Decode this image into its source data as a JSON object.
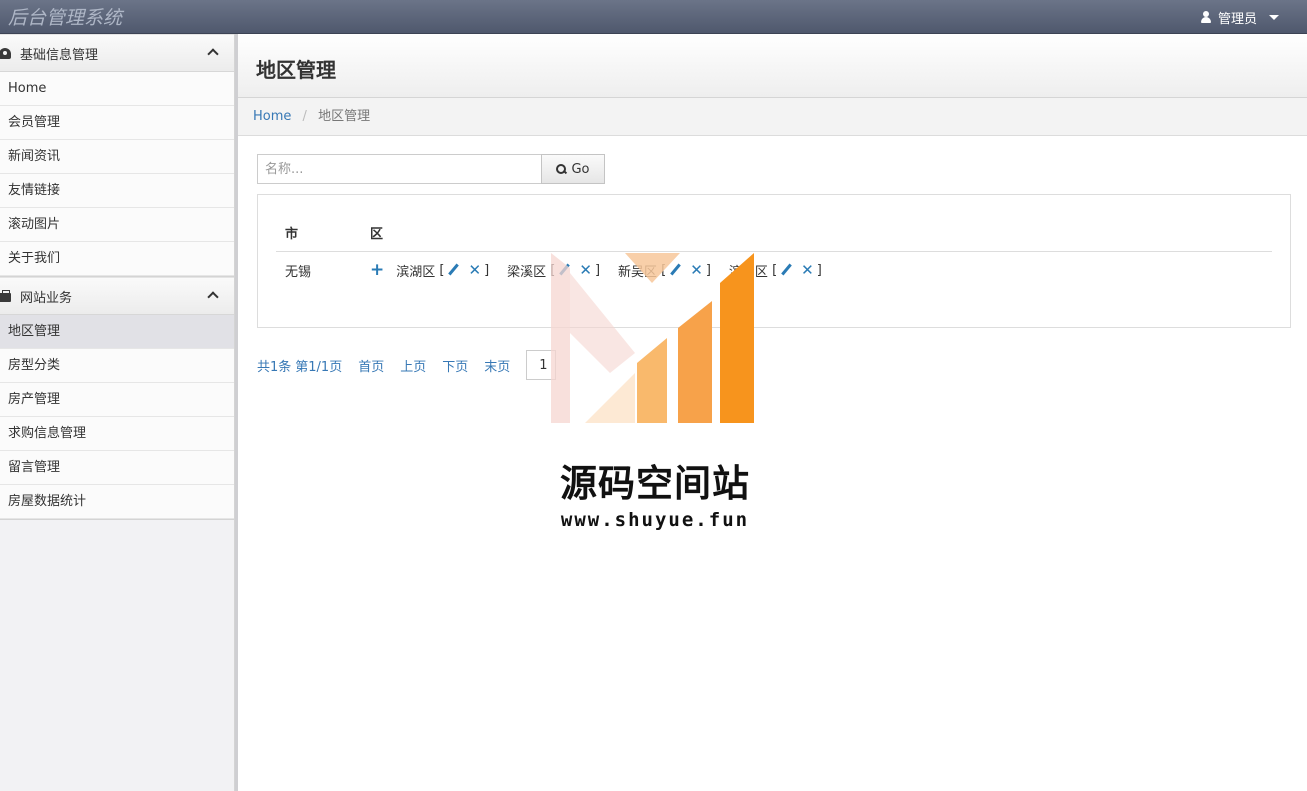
{
  "app": {
    "title": "后台管理系统",
    "user": "管理员"
  },
  "sidebar": {
    "groups": [
      {
        "label": "基础信息管理",
        "icon": "tachometer-icon",
        "items": [
          "Home",
          "会员管理",
          "新闻资讯",
          "友情链接",
          "滚动图片",
          "关于我们"
        ]
      },
      {
        "label": "网站业务",
        "icon": "briefcase-icon",
        "items": [
          "地区管理",
          "房型分类",
          "房产管理",
          "求购信息管理",
          "留言管理",
          "房屋数据统计"
        ]
      }
    ],
    "active_item": "地区管理"
  },
  "page": {
    "title": "地区管理",
    "breadcrumb": {
      "home": "Home",
      "current": "地区管理"
    }
  },
  "search": {
    "placeholder": "名称...",
    "button": "Go"
  },
  "table": {
    "headers": [
      "市",
      "区"
    ],
    "rows": [
      {
        "city": "无锡",
        "districts": [
          "滨湖区",
          "梁溪区",
          "新吴区",
          "滨湖区"
        ]
      }
    ]
  },
  "pagination": {
    "total": "共1条",
    "page_info": "第1/1页",
    "first": "首页",
    "prev": "上页",
    "next": "下页",
    "last": "末页",
    "page_input": "1"
  },
  "watermark": {
    "text": "源码空间站",
    "url": "www.shuyue.fun"
  },
  "colors": {
    "navbar": "#5a6378",
    "link": "#3778b5",
    "accent": "#f7941d"
  }
}
